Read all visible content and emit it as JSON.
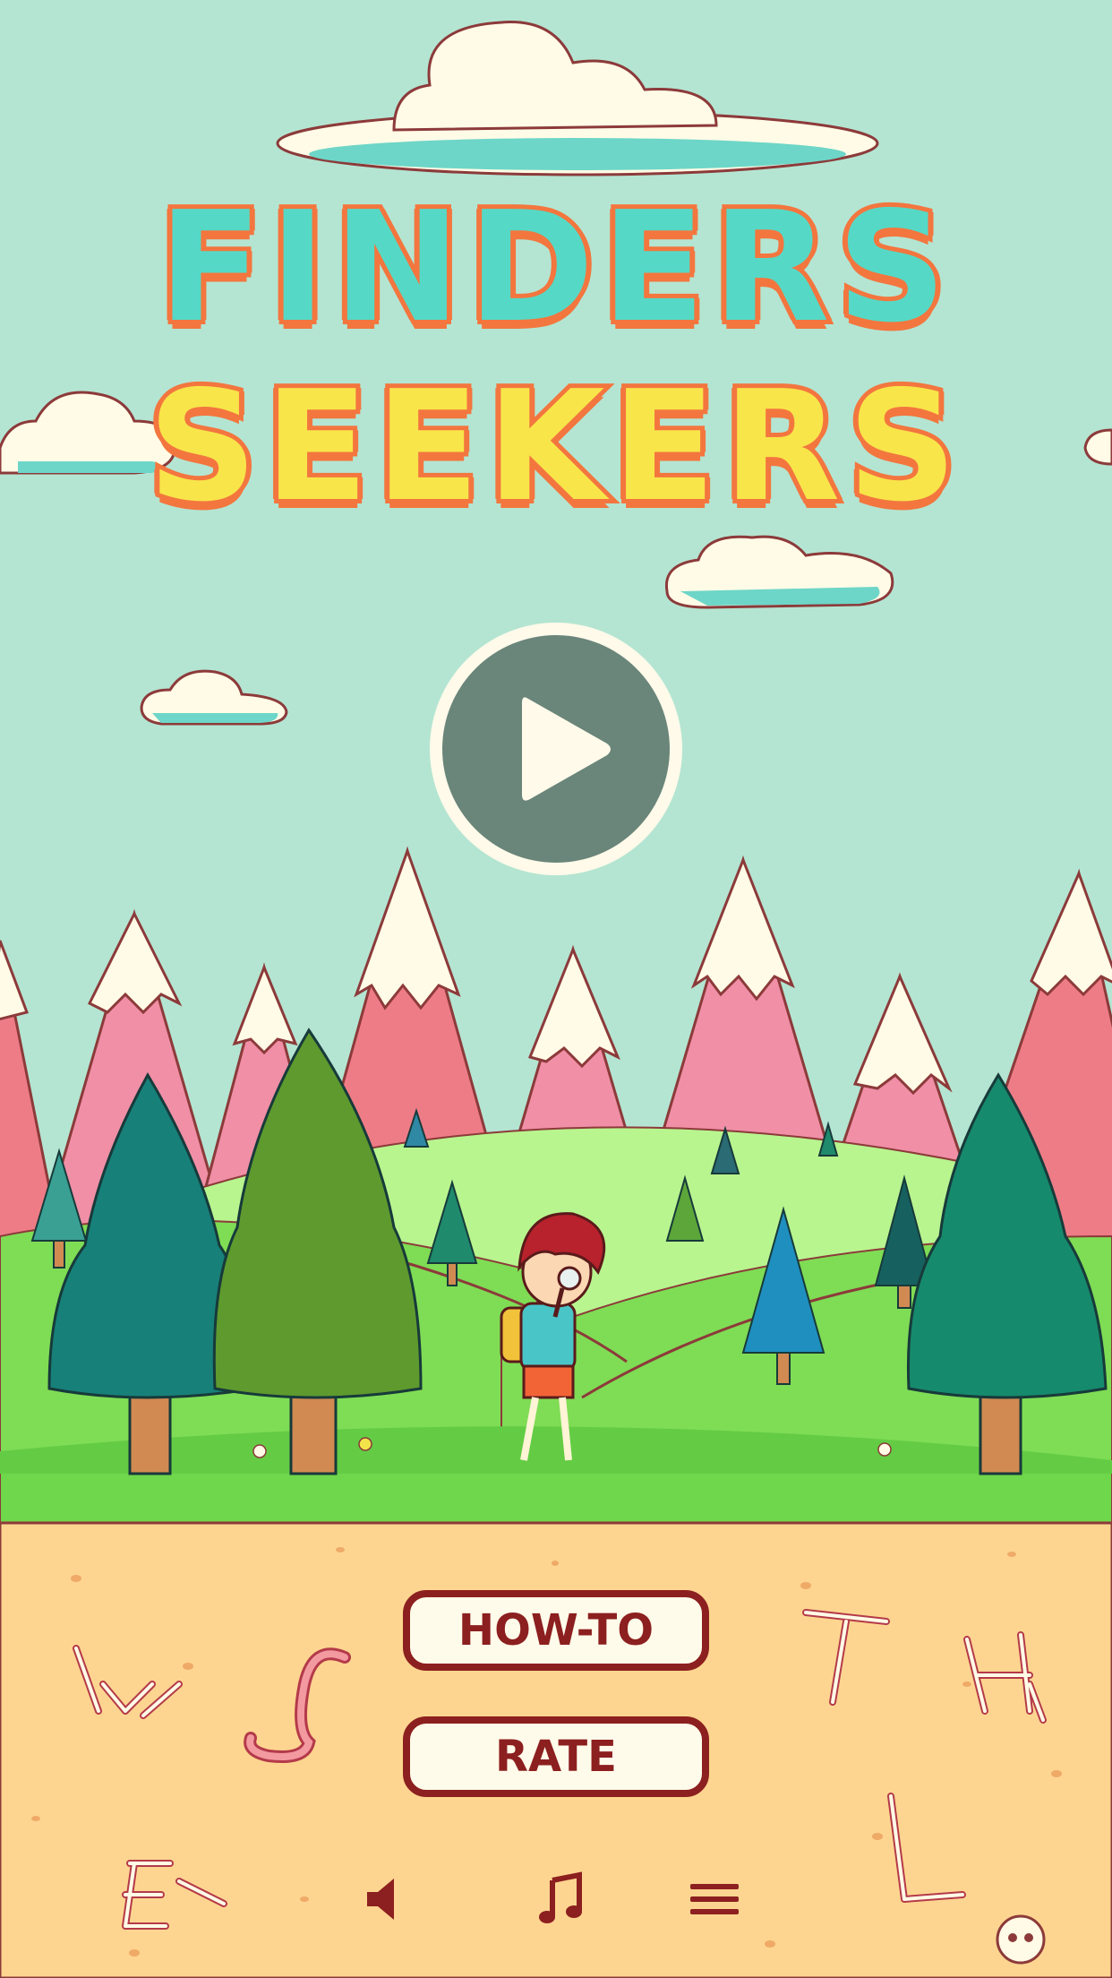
{
  "game": {
    "title_line_1": "FINDERS",
    "title_line_2": "SEEKERS"
  },
  "buttons": {
    "play_icon": "play-icon",
    "howto_label": "HOW-TO",
    "rate_label": "RATE"
  },
  "toolbar": {
    "icons": [
      "sound-icon",
      "music-icon",
      "menu-icon"
    ]
  },
  "colors": {
    "sky": "#b4e5d2",
    "title_teal": "#55d9c6",
    "title_yellow": "#f8e54a",
    "title_outline": "#f3763f",
    "play_button": "#6a857a",
    "button_border": "#8c1f1f",
    "sand": "#fdd590",
    "grass": "#6fd74b"
  }
}
